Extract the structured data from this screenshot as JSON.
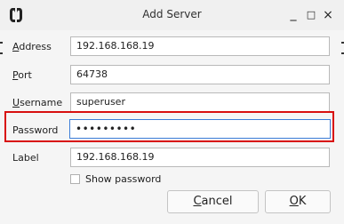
{
  "window": {
    "title": "Add Server",
    "icon": "mumble-logo-icon",
    "controls": {
      "minimize": "_",
      "maximize": "□",
      "close": "×"
    }
  },
  "form": {
    "address": {
      "label_mnemonic": "A",
      "label_rest": "ddress",
      "value": "192.168.168.19"
    },
    "port": {
      "label_mnemonic": "P",
      "label_rest": "ort",
      "value": "64738"
    },
    "username": {
      "label_mnemonic": "U",
      "label_rest": "sername",
      "value": "superuser"
    },
    "password": {
      "label": "Password",
      "value": "•••••••••"
    },
    "label": {
      "label": "Label",
      "value": "192.168.168.19"
    }
  },
  "show_password": {
    "label": "Show password",
    "checked": false
  },
  "buttons": {
    "cancel": {
      "mnemonic": "C",
      "rest": "ancel"
    },
    "ok": {
      "mnemonic": "O",
      "rest": "K"
    }
  },
  "colors": {
    "highlight": "#d80f0f",
    "focus": "#3b7dd8"
  }
}
